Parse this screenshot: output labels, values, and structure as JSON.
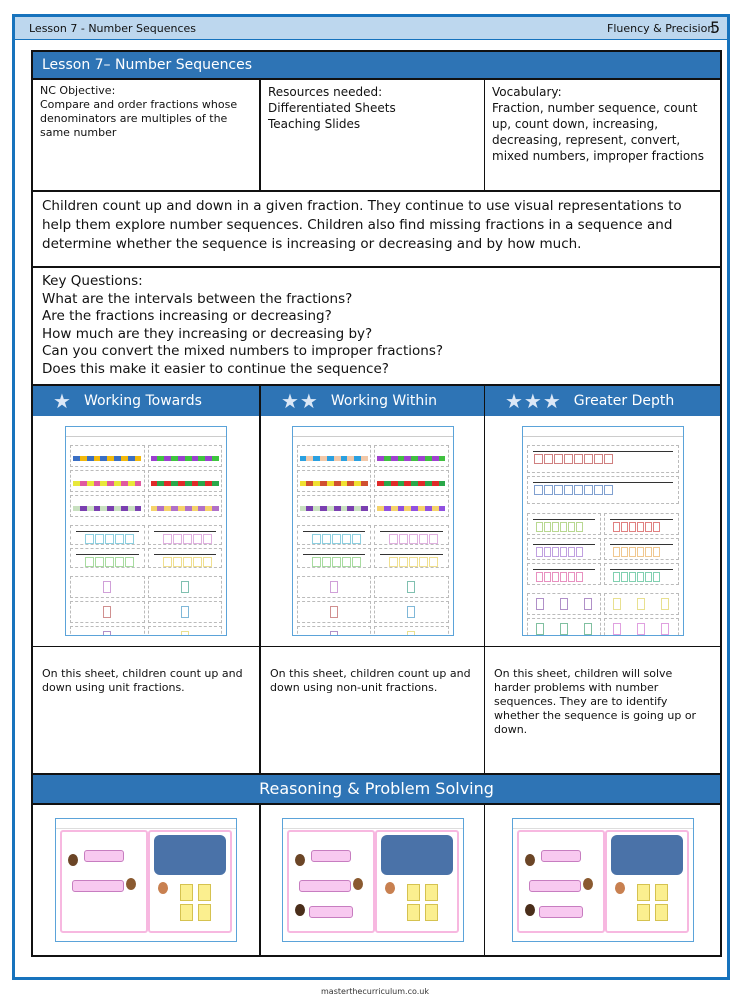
{
  "header": {
    "lesson": "Lesson 7  - Number Sequences",
    "section": "Fluency & Precision",
    "page_number": "5"
  },
  "plan": {
    "title": "Lesson 7– Number Sequences",
    "objective_label": "NC Objective:",
    "objective_text": "Compare and order fractions whose denominators are multiples of the same number",
    "resources_label": "Resources needed:",
    "resources": [
      "Differentiated Sheets",
      "Teaching Slides"
    ],
    "vocabulary_label": "Vocabulary:",
    "vocabulary_text": "Fraction, number sequence, count up, count down, increasing, decreasing, represent, convert, mixed numbers, improper fractions",
    "summary": "Children count up and down in a given fraction. They continue to use visual representations to help them explore number sequences. Children also find missing fractions in a sequence and determine whether the sequence is increasing or decreasing and by how much.",
    "key_questions_label": "Key Questions:",
    "key_questions": [
      "What are the intervals between the fractions?",
      "Are the fractions increasing or decreasing?",
      "How much are they increasing or decreasing by?",
      "Can you convert the mixed numbers to improper fractions?",
      "Does this make it easier to continue the sequence?"
    ]
  },
  "levels": [
    {
      "stars": "★",
      "label": "Working Towards",
      "description": "On this sheet, children count up and down using unit fractions."
    },
    {
      "stars": "★★",
      "label": "Working Within",
      "description": "On this sheet, children count up and down using non-unit fractions."
    },
    {
      "stars": "★★★",
      "label": "Greater Depth",
      "description": "On this sheet, children will solve harder problems with number sequences. They are to identify whether the sequence is going up or down."
    }
  ],
  "reasoning": {
    "title": "Reasoning & Problem Solving"
  },
  "footer": {
    "site": "masterthecurriculum.co.uk"
  },
  "colors": {
    "brand_blue": "#2e74b5",
    "frame_blue": "#1773bd",
    "header_light": "#bdd7ee"
  }
}
